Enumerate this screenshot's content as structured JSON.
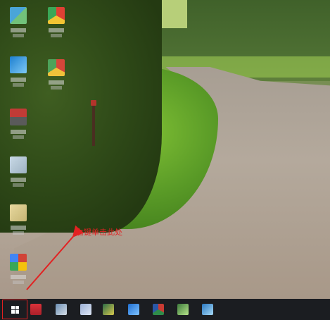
{
  "desktop": {
    "icons": [
      {
        "name": "desktop-icon-1",
        "icon": "app-icon"
      },
      {
        "name": "desktop-icon-2",
        "icon": "browser-icon"
      },
      {
        "name": "desktop-icon-3",
        "icon": "app-icon"
      },
      {
        "name": "desktop-icon-4",
        "icon": "browser-icon"
      },
      {
        "name": "desktop-icon-5",
        "icon": "app-icon"
      },
      {
        "name": "desktop-icon-6",
        "icon": "file-icon"
      },
      {
        "name": "desktop-icon-7",
        "icon": "file-icon"
      },
      {
        "name": "desktop-icon-8",
        "icon": "browser-icon"
      }
    ]
  },
  "annotation": {
    "text": "右键单击此处",
    "color": "#e22222"
  },
  "taskbar": {
    "start_icon": "windows-logo-icon",
    "highlight_color": "#e02020",
    "pinned": [
      "app-icon",
      "app-icon",
      "app-icon",
      "app-icon",
      "app-icon",
      "browser-icon",
      "app-icon",
      "app-icon"
    ]
  }
}
